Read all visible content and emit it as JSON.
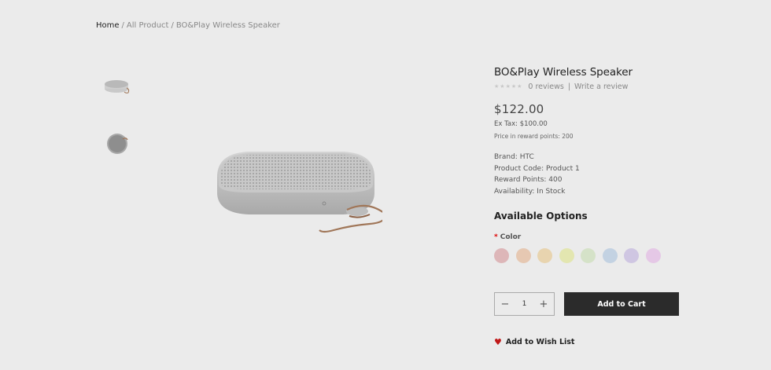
{
  "breadcrumb": {
    "home": "Home",
    "sep1": "/",
    "all_product": "All Product",
    "sep2": "/",
    "current": "BO&Play Wireless Speaker"
  },
  "product": {
    "title": "BO&Play Wireless Speaker",
    "reviews": "0 reviews",
    "review_divider": "|",
    "write_review": "Write a review",
    "rating_stars": 0,
    "price": "$122.00",
    "ex_tax": "Ex Tax: $100.00",
    "reward_points_price": "Price in reward points: 200",
    "brand": "Brand: HTC",
    "product_code": "Product Code: Product 1",
    "reward_points": "Reward Points: 400",
    "availability": "Availability: In Stock"
  },
  "options": {
    "title": "Available Options",
    "required_mark": "*",
    "color_label": "Color",
    "swatches": [
      "#ddb6b8",
      "#e6c8b2",
      "#e8d4af",
      "#e3e6b0",
      "#d5e2c8",
      "#c3d2e2",
      "#cfc6e2",
      "#e5c8e6"
    ]
  },
  "cart": {
    "minus": "−",
    "quantity": "1",
    "plus": "+",
    "add_to_cart": "Add to Cart"
  },
  "wishlist": {
    "label": "Add to Wish List",
    "icon": "heart-icon"
  }
}
